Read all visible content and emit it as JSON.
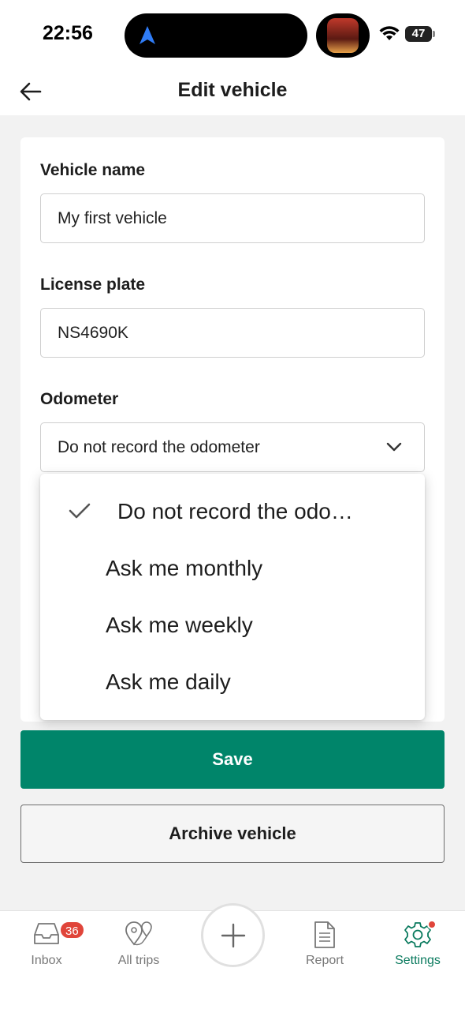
{
  "status_bar": {
    "time": "22:56",
    "battery": "47",
    "icons": [
      "navigation-arrow-icon",
      "live-activity-app-icon",
      "wifi-icon",
      "battery-icon"
    ]
  },
  "header": {
    "title": "Edit vehicle",
    "back_icon": "arrow-left-icon"
  },
  "form": {
    "vehicle_name": {
      "label": "Vehicle name",
      "value": "My first vehicle"
    },
    "license_plate": {
      "label": "License plate",
      "value": "NS4690K"
    },
    "odometer": {
      "label": "Odometer",
      "value": "Do not record the odometer",
      "chevron_icon": "chevron-down-icon"
    }
  },
  "dropdown": {
    "options": [
      {
        "label": "Do not record the odo…",
        "selected": true
      },
      {
        "label": "Ask me monthly",
        "selected": false
      },
      {
        "label": "Ask me weekly",
        "selected": false
      },
      {
        "label": "Ask me daily",
        "selected": false
      }
    ]
  },
  "actions": {
    "save_label": "Save",
    "archive_label": "Archive vehicle"
  },
  "bottom_nav": {
    "inbox": {
      "label": "Inbox",
      "badge": "36",
      "icon": "inbox-tray-icon"
    },
    "all_trips": {
      "label": "All trips",
      "icon": "map-pins-icon"
    },
    "add": {
      "icon": "plus-icon"
    },
    "report": {
      "label": "Report",
      "icon": "document-icon"
    },
    "settings": {
      "label": "Settings",
      "icon": "gear-icon",
      "active": true
    }
  },
  "colors": {
    "accent": "#00856a",
    "active_nav": "#0a7a5e",
    "badge": "#e0453a",
    "background": "#f2f2f2"
  }
}
